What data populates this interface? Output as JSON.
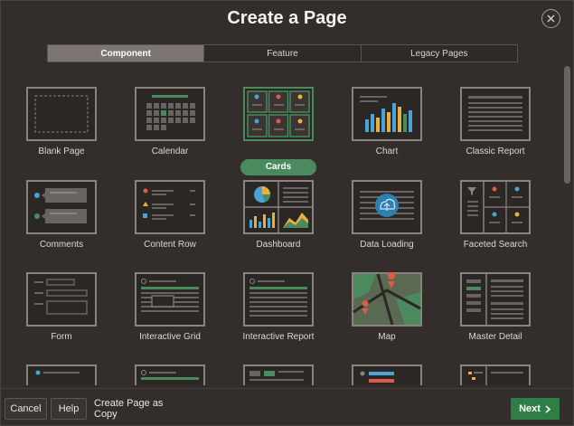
{
  "dialog": {
    "title": "Create a Page",
    "close_icon": "close-icon"
  },
  "tabs": [
    {
      "label": "Component",
      "active": true
    },
    {
      "label": "Feature",
      "active": false
    },
    {
      "label": "Legacy Pages",
      "active": false
    }
  ],
  "tiles": [
    {
      "label": "Blank Page",
      "icon": "blank-page-icon"
    },
    {
      "label": "Calendar",
      "icon": "calendar-icon"
    },
    {
      "label": "Cards",
      "icon": "cards-icon",
      "selected": true
    },
    {
      "label": "Chart",
      "icon": "chart-icon"
    },
    {
      "label": "Classic Report",
      "icon": "classic-report-icon"
    },
    {
      "label": "Comments",
      "icon": "comments-icon"
    },
    {
      "label": "Content Row",
      "icon": "content-row-icon"
    },
    {
      "label": "Dashboard",
      "icon": "dashboard-icon"
    },
    {
      "label": "Data Loading",
      "icon": "data-loading-icon"
    },
    {
      "label": "Faceted Search",
      "icon": "faceted-search-icon"
    },
    {
      "label": "Form",
      "icon": "form-icon"
    },
    {
      "label": "Interactive Grid",
      "icon": "interactive-grid-icon"
    },
    {
      "label": "Interactive Report",
      "icon": "interactive-report-icon"
    },
    {
      "label": "Map",
      "icon": "map-icon"
    },
    {
      "label": "Master Detail",
      "icon": "master-detail-icon"
    }
  ],
  "footer": {
    "cancel_label": "Cancel",
    "help_label": "Help",
    "copy_label": "Create Page as Copy",
    "next_label": "Next"
  },
  "colors": {
    "selected_green": "#4a8a5e",
    "next_button": "#2f7d47",
    "active_tab": "#7d7571"
  }
}
